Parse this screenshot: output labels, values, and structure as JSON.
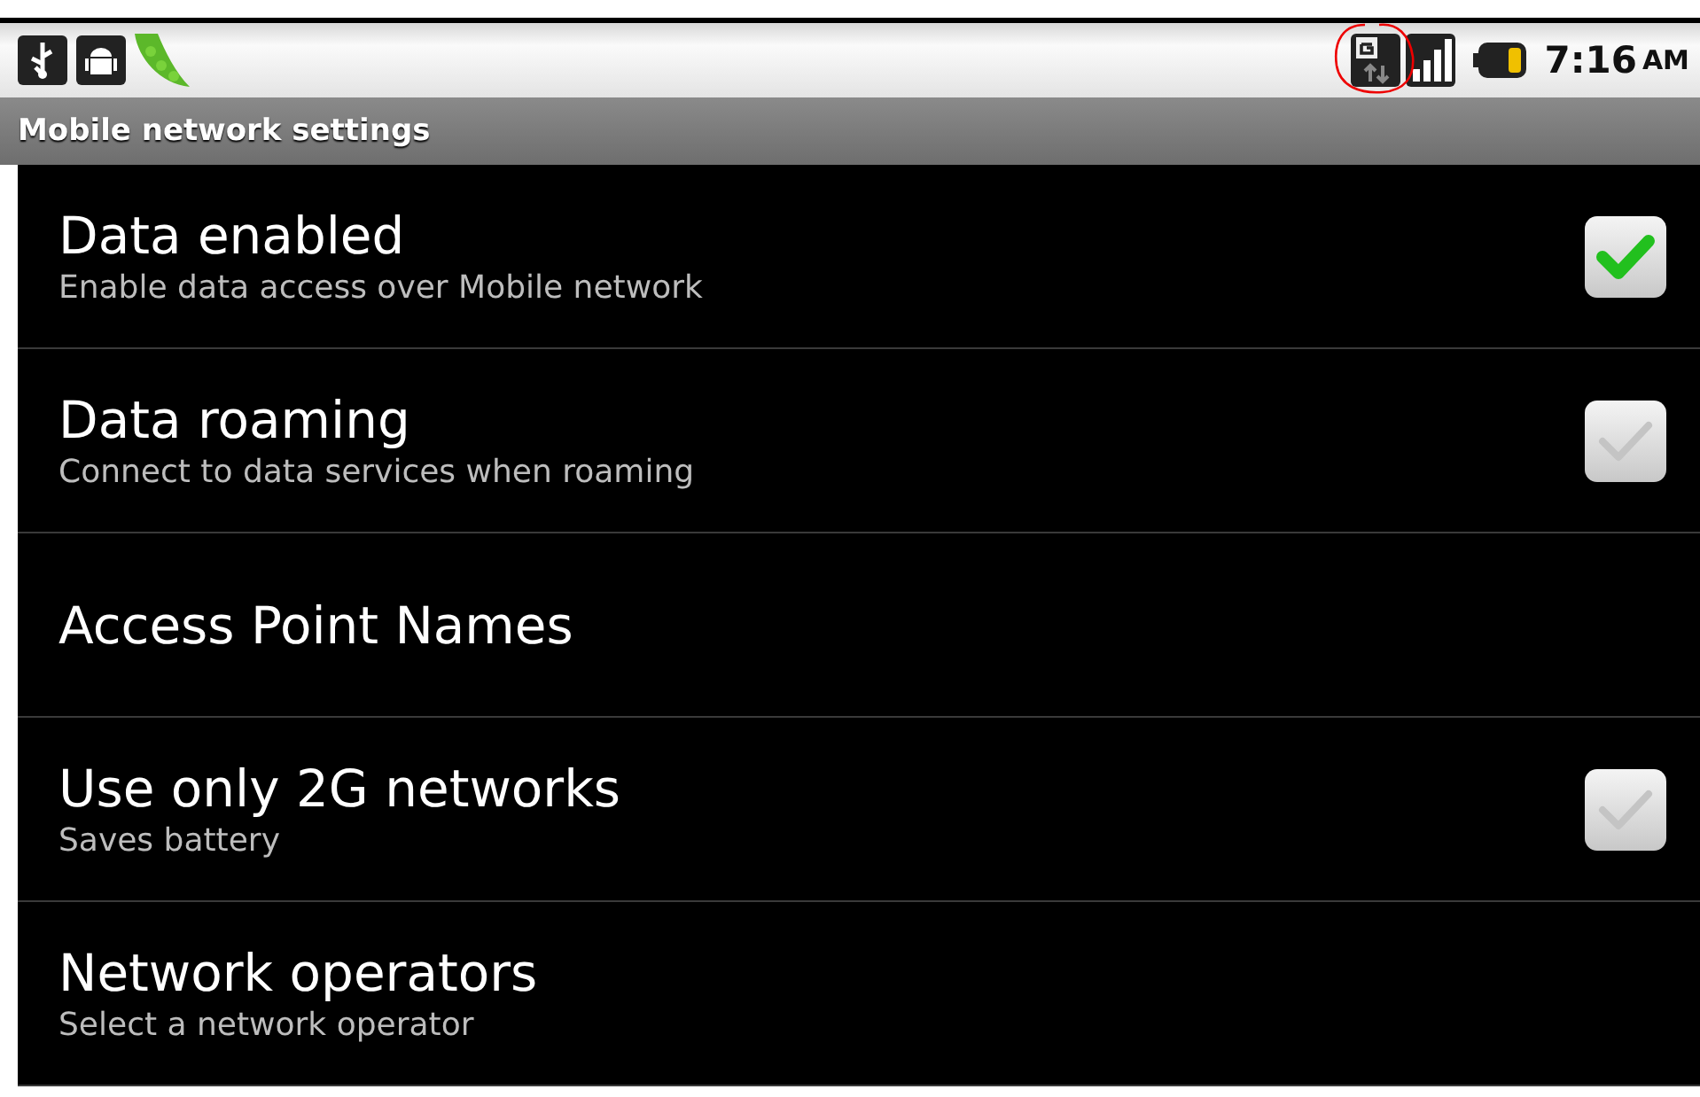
{
  "status_bar": {
    "time": "7:16",
    "meridiem": "AM"
  },
  "title": "Mobile network settings",
  "settings": [
    {
      "kind": "checkbox",
      "title": "Data enabled",
      "summary": "Enable data access over Mobile network",
      "checked": true
    },
    {
      "kind": "checkbox",
      "title": "Data roaming",
      "summary": "Connect to data services when roaming",
      "checked": false
    },
    {
      "kind": "plain",
      "title": "Access Point Names"
    },
    {
      "kind": "checkbox",
      "title": "Use only 2G networks",
      "summary": "Saves battery",
      "checked": false
    },
    {
      "kind": "plain",
      "title": "Network operators",
      "summary": "Select a network operator"
    }
  ]
}
